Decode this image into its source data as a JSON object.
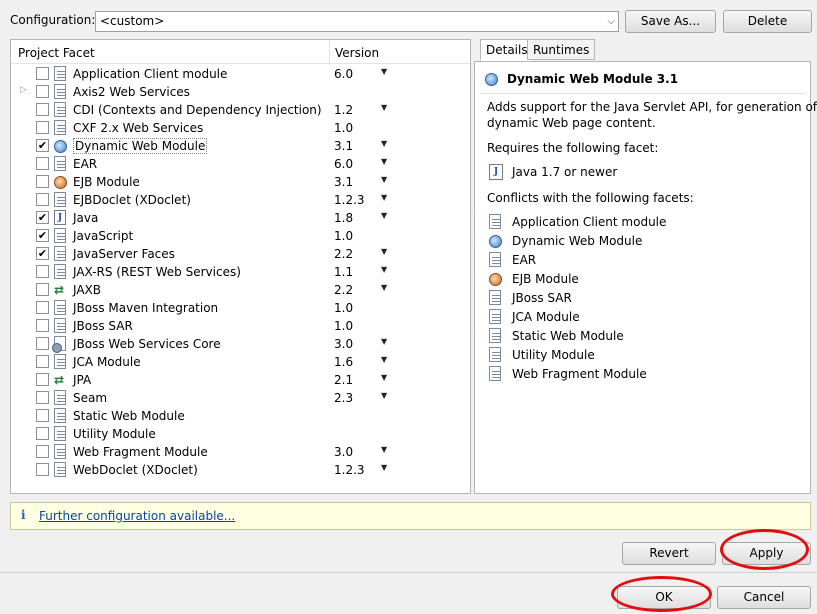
{
  "config": {
    "label": "Configuration:",
    "value": "<custom>",
    "save_as": "Save As...",
    "delete": "Delete"
  },
  "table": {
    "col_facet": "Project Facet",
    "col_version": "Version",
    "rows": [
      {
        "name": "Application Client module",
        "version": "6.0",
        "checked": false,
        "icon": "document-icon",
        "dropdown": true,
        "expandable": false
      },
      {
        "name": "Axis2 Web Services",
        "version": "",
        "checked": false,
        "icon": "document-icon",
        "dropdown": false,
        "expandable": true
      },
      {
        "name": "CDI (Contexts and Dependency Injection)",
        "version": "1.2",
        "checked": false,
        "icon": "document-icon",
        "dropdown": true,
        "expandable": false
      },
      {
        "name": "CXF 2.x Web Services",
        "version": "1.0",
        "checked": false,
        "icon": "document-icon",
        "dropdown": false,
        "expandable": false
      },
      {
        "name": "Dynamic Web Module",
        "version": "3.1",
        "checked": true,
        "icon": "globe-icon",
        "dropdown": true,
        "expandable": false,
        "selected": true
      },
      {
        "name": "EAR",
        "version": "6.0",
        "checked": false,
        "icon": "document-icon",
        "dropdown": true,
        "expandable": false
      },
      {
        "name": "EJB Module",
        "version": "3.1",
        "checked": false,
        "icon": "bean-icon",
        "dropdown": true,
        "expandable": false
      },
      {
        "name": "EJBDoclet (XDoclet)",
        "version": "1.2.3",
        "checked": false,
        "icon": "document-icon",
        "dropdown": true,
        "expandable": false
      },
      {
        "name": "Java",
        "version": "1.8",
        "checked": true,
        "icon": "java-file-icon",
        "dropdown": true,
        "expandable": false
      },
      {
        "name": "JavaScript",
        "version": "1.0",
        "checked": true,
        "icon": "document-icon",
        "dropdown": false,
        "expandable": false
      },
      {
        "name": "JavaServer Faces",
        "version": "2.2",
        "checked": true,
        "icon": "document-icon",
        "dropdown": true,
        "expandable": false
      },
      {
        "name": "JAX-RS (REST Web Services)",
        "version": "1.1",
        "checked": false,
        "icon": "document-icon",
        "dropdown": true,
        "expandable": false
      },
      {
        "name": "JAXB",
        "version": "2.2",
        "checked": false,
        "icon": "transform-arrows-icon",
        "dropdown": true,
        "expandable": false
      },
      {
        "name": "JBoss Maven Integration",
        "version": "1.0",
        "checked": false,
        "icon": "document-icon",
        "dropdown": false,
        "expandable": false
      },
      {
        "name": "JBoss SAR",
        "version": "1.0",
        "checked": false,
        "icon": "document-icon",
        "dropdown": false,
        "expandable": false
      },
      {
        "name": "JBoss Web Services Core",
        "version": "3.0",
        "checked": false,
        "icon": "gear-document-icon",
        "dropdown": true,
        "expandable": false
      },
      {
        "name": "JCA Module",
        "version": "1.6",
        "checked": false,
        "icon": "document-icon",
        "dropdown": true,
        "expandable": false
      },
      {
        "name": "JPA",
        "version": "2.1",
        "checked": false,
        "icon": "transform-arrows-icon",
        "dropdown": true,
        "expandable": false
      },
      {
        "name": "Seam",
        "version": "2.3",
        "checked": false,
        "icon": "document-icon",
        "dropdown": true,
        "expandable": false
      },
      {
        "name": "Static Web Module",
        "version": "",
        "checked": false,
        "icon": "document-icon",
        "dropdown": false,
        "expandable": false
      },
      {
        "name": "Utility Module",
        "version": "",
        "checked": false,
        "icon": "document-icon",
        "dropdown": false,
        "expandable": false
      },
      {
        "name": "Web Fragment Module",
        "version": "3.0",
        "checked": false,
        "icon": "document-icon",
        "dropdown": true,
        "expandable": false
      },
      {
        "name": "WebDoclet (XDoclet)",
        "version": "1.2.3",
        "checked": false,
        "icon": "document-icon",
        "dropdown": true,
        "expandable": false
      }
    ]
  },
  "tabs": [
    {
      "label": "Details",
      "active": true
    },
    {
      "label": "Runtimes",
      "active": false
    }
  ],
  "details": {
    "title": "Dynamic Web Module 3.1",
    "description_line1": "Adds support for the Java Servlet API, for generation of",
    "description_line2": "dynamic Web page content.",
    "requires_label": "Requires the following facet:",
    "requires": [
      {
        "name": "Java 1.7 or newer",
        "icon": "java-file-icon"
      }
    ],
    "conflicts_label": "Conflicts with the following facets:",
    "conflicts": [
      {
        "name": "Application Client module",
        "icon": "document-icon"
      },
      {
        "name": "Dynamic Web Module",
        "icon": "globe-icon"
      },
      {
        "name": "EAR",
        "icon": "document-icon"
      },
      {
        "name": "EJB Module",
        "icon": "bean-icon"
      },
      {
        "name": "JBoss SAR",
        "icon": "document-icon"
      },
      {
        "name": "JCA Module",
        "icon": "document-icon"
      },
      {
        "name": "Static Web Module",
        "icon": "document-icon"
      },
      {
        "name": "Utility Module",
        "icon": "document-icon"
      },
      {
        "name": "Web Fragment Module",
        "icon": "document-icon"
      }
    ]
  },
  "info": {
    "icon": "info-icon",
    "link": "Further configuration available..."
  },
  "buttons": {
    "revert": "Revert",
    "apply": "Apply",
    "ok": "OK",
    "cancel": "Cancel"
  },
  "highlight_color": "#e01010"
}
